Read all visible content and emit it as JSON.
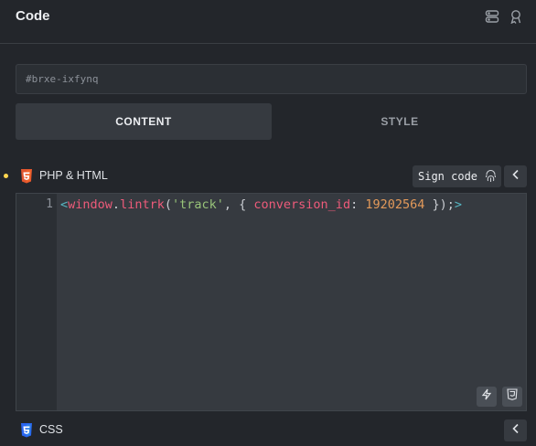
{
  "header": {
    "title": "Code",
    "icons": [
      "server-icon",
      "badge-icon"
    ]
  },
  "element_id": {
    "placeholder": "#brxe-ixfynq"
  },
  "tabs": [
    {
      "label": "CONTENT",
      "active": true
    },
    {
      "label": "STYLE",
      "active": false
    }
  ],
  "php_section": {
    "label": "PHP & HTML",
    "icon": "html5-icon",
    "sign_button_label": "Sign code",
    "has_changes_indicator_color": "#ffd64f"
  },
  "editor": {
    "line_number": "1",
    "code_tokens": [
      {
        "text": "<",
        "kind": "tag"
      },
      {
        "text": "window",
        "kind": "name"
      },
      {
        "text": ".",
        "kind": "punc"
      },
      {
        "text": "lintrk",
        "kind": "name"
      },
      {
        "text": "(",
        "kind": "punc"
      },
      {
        "text": "'track'",
        "kind": "str"
      },
      {
        "text": ", { ",
        "kind": "punc"
      },
      {
        "text": "conversion_id",
        "kind": "name"
      },
      {
        "text": ": ",
        "kind": "punc"
      },
      {
        "text": "19202564",
        "kind": "num"
      },
      {
        "text": " });",
        "kind": "punc"
      },
      {
        "text": ">",
        "kind": "tag"
      }
    ],
    "tools": [
      "bolt-icon",
      "html5-icon"
    ]
  },
  "css_section": {
    "label": "CSS",
    "icon": "css3-icon"
  },
  "colors": {
    "background": "#23262b",
    "panel": "#363a40",
    "accent_dot": "#ffd64f",
    "html_icon": "#e4572e",
    "css_icon": "#2965f1"
  }
}
